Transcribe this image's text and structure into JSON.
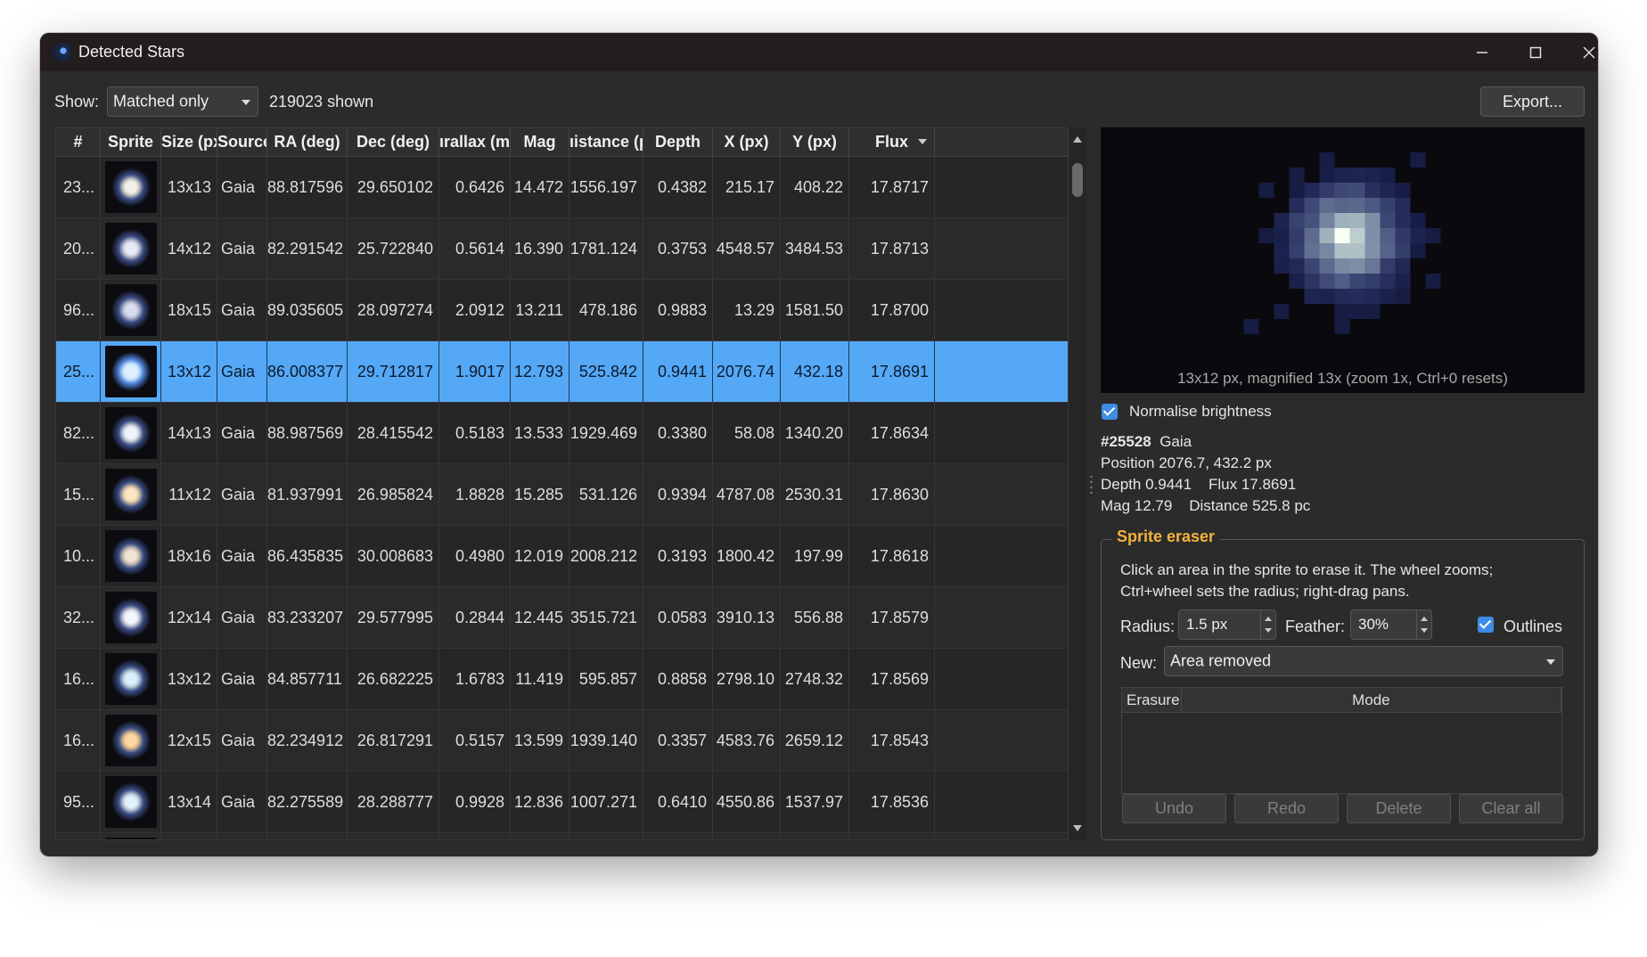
{
  "window": {
    "title": "Detected Stars"
  },
  "toolbar": {
    "show_label": "Show:",
    "show_value": "Matched only",
    "shown_count": "219023 shown",
    "export_label": "Export..."
  },
  "table": {
    "columns": [
      "#",
      "Sprite",
      "Size (px)",
      "Source",
      "RA (deg)",
      "Dec (deg)",
      "ırallax (ma",
      "Mag",
      "ıistance (pc",
      "Depth",
      "X (px)",
      "Y (px)",
      "Flux"
    ],
    "sorted_column": "Flux",
    "selected_row": 3,
    "rows": [
      {
        "id": "23...",
        "size": "13x13",
        "source": "Gaia",
        "ra": "88.817596",
        "dec": "29.650102",
        "parallax": "0.6426",
        "mag": "14.472",
        "distance": "1556.197",
        "depth": "0.4382",
        "x": "215.17",
        "y": "408.22",
        "flux": "17.8717",
        "sprite_color": "#f2f0e6"
      },
      {
        "id": "20...",
        "size": "14x12",
        "source": "Gaia",
        "ra": "82.291542",
        "dec": "25.722840",
        "parallax": "0.5614",
        "mag": "16.390",
        "distance": "1781.124",
        "depth": "0.3753",
        "x": "4548.57",
        "y": "3484.53",
        "flux": "17.8713",
        "sprite_color": "#e8eaf8"
      },
      {
        "id": "96...",
        "size": "18x15",
        "source": "Gaia",
        "ra": "89.035605",
        "dec": "28.097274",
        "parallax": "2.0912",
        "mag": "13.211",
        "distance": "478.186",
        "depth": "0.9883",
        "x": "13.29",
        "y": "1581.50",
        "flux": "17.8700",
        "sprite_color": "#d8dcf2"
      },
      {
        "id": "25...",
        "size": "13x12",
        "source": "Gaia",
        "ra": "86.008377",
        "dec": "29.712817",
        "parallax": "1.9017",
        "mag": "12.793",
        "distance": "525.842",
        "depth": "0.9441",
        "x": "2076.74",
        "y": "432.18",
        "flux": "17.8691",
        "sprite_color": "#dff0ff"
      },
      {
        "id": "82...",
        "size": "14x13",
        "source": "Gaia",
        "ra": "88.987569",
        "dec": "28.415542",
        "parallax": "0.5183",
        "mag": "13.533",
        "distance": "1929.469",
        "depth": "0.3380",
        "x": "58.08",
        "y": "1340.20",
        "flux": "17.8634",
        "sprite_color": "#eef4ff"
      },
      {
        "id": "15...",
        "size": "11x12",
        "source": "Gaia",
        "ra": "81.937991",
        "dec": "26.985824",
        "parallax": "1.8828",
        "mag": "15.285",
        "distance": "531.126",
        "depth": "0.9394",
        "x": "4787.08",
        "y": "2530.31",
        "flux": "17.8630",
        "sprite_color": "#ffe6c2"
      },
      {
        "id": "10...",
        "size": "18x16",
        "source": "Gaia",
        "ra": "86.435835",
        "dec": "30.008683",
        "parallax": "0.4980",
        "mag": "12.019",
        "distance": "2008.212",
        "depth": "0.3193",
        "x": "1800.42",
        "y": "197.99",
        "flux": "17.8618",
        "sprite_color": "#f0e2d4"
      },
      {
        "id": "32...",
        "size": "12x14",
        "source": "Gaia",
        "ra": "83.233207",
        "dec": "29.577995",
        "parallax": "0.2844",
        "mag": "12.445",
        "distance": "3515.721",
        "depth": "0.0583",
        "x": "3910.13",
        "y": "556.88",
        "flux": "17.8579",
        "sprite_color": "#f4f6ff"
      },
      {
        "id": "16...",
        "size": "13x12",
        "source": "Gaia",
        "ra": "84.857711",
        "dec": "26.682225",
        "parallax": "1.6783",
        "mag": "11.419",
        "distance": "595.857",
        "depth": "0.8858",
        "x": "2798.10",
        "y": "2748.32",
        "flux": "17.8569",
        "sprite_color": "#d8f0ff"
      },
      {
        "id": "16...",
        "size": "12x15",
        "source": "Gaia",
        "ra": "82.234912",
        "dec": "26.817291",
        "parallax": "0.5157",
        "mag": "13.599",
        "distance": "1939.140",
        "depth": "0.3357",
        "x": "4583.76",
        "y": "2659.12",
        "flux": "17.8543",
        "sprite_color": "#ffd8a0"
      },
      {
        "id": "95...",
        "size": "13x14",
        "source": "Gaia",
        "ra": "82.275589",
        "dec": "28.288777",
        "parallax": "0.9928",
        "mag": "12.836",
        "distance": "1007.271",
        "depth": "0.6410",
        "x": "4550.86",
        "y": "1537.97",
        "flux": "17.8536",
        "sprite_color": "#e2f0ff"
      }
    ]
  },
  "preview": {
    "caption": "13x12 px, magnified 13x  (zoom 1x, Ctrl+0 resets)",
    "normalise_label": "Normalise brightness",
    "normalise_checked": true
  },
  "details": {
    "id": "#25528",
    "source": "Gaia",
    "position": "Position 2076.7, 432.2 px",
    "depth_flux": "Depth 0.9441    Flux 17.8691",
    "mag_distance": "Mag 12.79    Distance 525.8 pc"
  },
  "eraser": {
    "title": "Sprite eraser",
    "help_line1": "Click an area in the sprite to erase it. The wheel zooms;",
    "help_line2": "Ctrl+wheel sets the radius; right-drag pans.",
    "radius_label": "Radius:",
    "radius_value": "1.5 px",
    "feather_label": "Feather:",
    "feather_value": "30%",
    "outlines_label": "Outlines",
    "outlines_checked": true,
    "new_label": "New:",
    "new_value": "Area removed",
    "list_columns": [
      "Erasure",
      "Mode"
    ],
    "buttons": {
      "undo": "Undo",
      "redo": "Redo",
      "delete": "Delete",
      "clear": "Clear all"
    }
  },
  "colors": {
    "accent": "#55a8f5",
    "group_title": "#f2b33d",
    "window_bg": "#2b2b2b",
    "titlebar_bg": "#241d1d"
  }
}
